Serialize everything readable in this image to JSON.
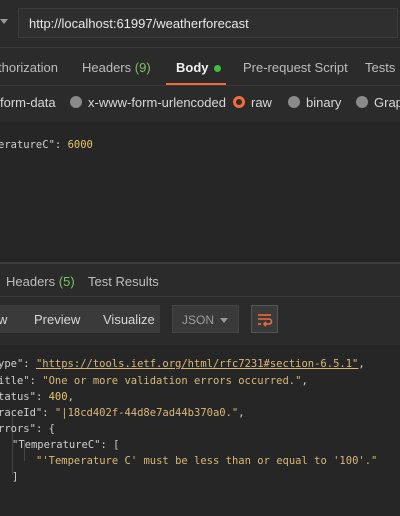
{
  "request": {
    "url": "http://localhost:61997/weatherforecast"
  },
  "request_tabs": [
    {
      "label": "thorization"
    },
    {
      "label": "Headers",
      "count": "(9)"
    },
    {
      "label": "Body"
    },
    {
      "label": "Pre-request Script"
    },
    {
      "label": "Tests"
    }
  ],
  "body_types": [
    {
      "label": "form-data"
    },
    {
      "label": "x-www-form-urlencoded"
    },
    {
      "label": "raw"
    },
    {
      "label": "binary"
    },
    {
      "label": "Grap"
    }
  ],
  "request_body": {
    "key": "eratureC\"",
    "sep": ": ",
    "value": "6000"
  },
  "response_tabs": [
    {
      "label": "Headers",
      "count": "(5)"
    },
    {
      "label": "Test Results"
    }
  ],
  "view_buttons": {
    "pretty_fragment": "w",
    "preview": "Preview",
    "visualize": "Visualize",
    "format": "JSON"
  },
  "response": {
    "type_key": "ype\"",
    "type_value": "\"https://tools.ietf.org/html/rfc7231#section-6.5.1\"",
    "title_key": "itle\"",
    "title_value": "\"One or more validation errors occurred.\"",
    "status_key": "tatus\"",
    "status_value": "400",
    "trace_key": "raceId\"",
    "trace_value": "\"|18cd402f-44d8e7ad44b370a0.\"",
    "errors_key": "rrors\"",
    "errors_open": "{",
    "temp_key": "\"TemperatureC\"",
    "temp_open": "[",
    "message": "\"'Temperature C' must be less than or equal to '100'.\"",
    "temp_close": "]"
  },
  "colors": {
    "accent": "#f26b3a",
    "count_green": "#7cbf6a",
    "string": "#d9b878"
  }
}
